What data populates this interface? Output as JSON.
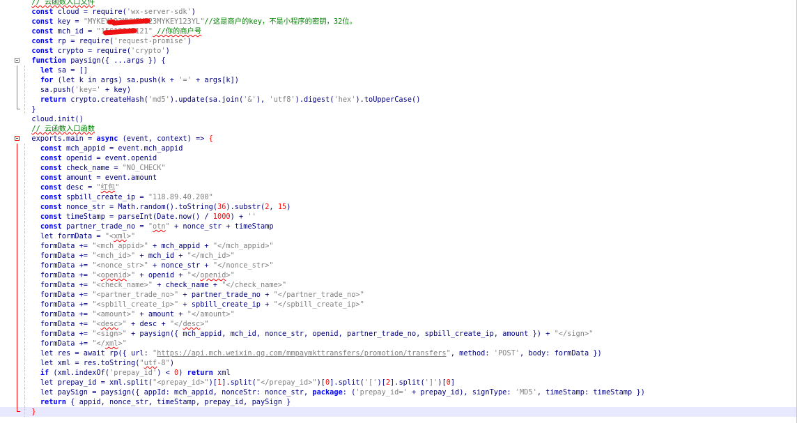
{
  "editor": {
    "lines": [
      [
        {
          "t": "  "
        },
        {
          "t": "// 云函数入口文件",
          "c": "cm",
          "u": true
        }
      ],
      [
        {
          "t": "  "
        },
        {
          "t": "const",
          "c": "kw"
        },
        {
          "t": " cloud = require("
        },
        {
          "t": "'wx-server-sdk'",
          "c": "st"
        },
        {
          "t": ")"
        }
      ],
      [
        {
          "t": "  "
        },
        {
          "t": "const",
          "c": "kw"
        },
        {
          "t": " key = "
        },
        {
          "t": "\"MYKEY",
          "c": "st"
        },
        {
          "t": "1",
          "c": "st",
          "r": true
        },
        {
          "t": "23MYKEY1",
          "c": "st",
          "r": true
        },
        {
          "t": "23MYKEY123YL\"",
          "c": "st"
        },
        {
          "t": "//这是商户的key，不是小程序的密钥，32位。",
          "c": "cm"
        }
      ],
      [
        {
          "t": "  "
        },
        {
          "t": "const",
          "c": "kw"
        },
        {
          "t": " mch_id = "
        },
        {
          "t": "\"1",
          "c": "st"
        },
        {
          "t": "5612345",
          "c": "st",
          "r": true
        },
        {
          "t": "121\"",
          "c": "st"
        },
        {
          "t": " //你的商户号",
          "c": "cm",
          "u": true
        }
      ],
      [
        {
          "t": "  "
        },
        {
          "t": "const",
          "c": "kw"
        },
        {
          "t": " rp = require("
        },
        {
          "t": "'request-promise'",
          "c": "st"
        },
        {
          "t": ")"
        }
      ],
      [
        {
          "t": "  "
        },
        {
          "t": "const",
          "c": "kw"
        },
        {
          "t": " crypto = require("
        },
        {
          "t": "'crypto'",
          "c": "st"
        },
        {
          "t": ")"
        }
      ],
      [
        {
          "t": "  "
        },
        {
          "t": "function",
          "c": "kw"
        },
        {
          "t": " paysign({ ...args }) {"
        }
      ],
      [
        {
          "t": "    "
        },
        {
          "t": "let",
          "c": "kw"
        },
        {
          "t": " sa = []"
        }
      ],
      [
        {
          "t": "    "
        },
        {
          "t": "for",
          "c": "kw"
        },
        {
          "t": " (let k in args) sa.push(k + "
        },
        {
          "t": "'='",
          "c": "st"
        },
        {
          "t": " + args[k])"
        }
      ],
      [
        {
          "t": "    "
        },
        {
          "t": "sa.push("
        },
        {
          "t": "'key='",
          "c": "st"
        },
        {
          "t": " + key)"
        }
      ],
      [
        {
          "t": "    "
        },
        {
          "t": "return",
          "c": "kw"
        },
        {
          "t": " crypto.createHash("
        },
        {
          "t": "'md5'",
          "c": "st"
        },
        {
          "t": ").update(sa.join("
        },
        {
          "t": "'&'",
          "c": "st"
        },
        {
          "t": "), "
        },
        {
          "t": "'utf8'",
          "c": "st"
        },
        {
          "t": ").digest("
        },
        {
          "t": "'hex'",
          "c": "st"
        },
        {
          "t": ").toUpperCase()"
        }
      ],
      [
        {
          "t": "  "
        },
        {
          "t": "}"
        }
      ],
      [
        {
          "t": "  "
        },
        {
          "t": "cloud.init()"
        }
      ],
      [
        {
          "t": "  "
        },
        {
          "t": "// 云函数入口函数",
          "c": "cm",
          "u": true
        }
      ],
      [
        {
          "t": "  "
        },
        {
          "t": "exports.main = "
        },
        {
          "t": "async",
          "c": "kw"
        },
        {
          "t": " (event, context) => "
        },
        {
          "t": "{",
          "c": "brk"
        }
      ],
      [
        {
          "t": "    "
        },
        {
          "t": "const",
          "c": "kw"
        },
        {
          "t": " mch_appid = event.mch_appid"
        }
      ],
      [
        {
          "t": "    "
        },
        {
          "t": "const",
          "c": "kw"
        },
        {
          "t": " openid = event.openid"
        }
      ],
      [
        {
          "t": "    "
        },
        {
          "t": "const",
          "c": "kw"
        },
        {
          "t": " check_name = "
        },
        {
          "t": "\"NO_CHECK\"",
          "c": "st"
        }
      ],
      [
        {
          "t": "    "
        },
        {
          "t": "const",
          "c": "kw"
        },
        {
          "t": " amount = event.amount"
        }
      ],
      [
        {
          "t": "    "
        },
        {
          "t": "const",
          "c": "kw"
        },
        {
          "t": " desc = "
        },
        {
          "t": "\"",
          "c": "st"
        },
        {
          "t": "红包",
          "c": "st",
          "u": true
        },
        {
          "t": "\"",
          "c": "st"
        }
      ],
      [
        {
          "t": "    "
        },
        {
          "t": "const",
          "c": "kw"
        },
        {
          "t": " spbill_create_ip = "
        },
        {
          "t": "\"118.89.40.200\"",
          "c": "st"
        }
      ],
      [
        {
          "t": "    "
        },
        {
          "t": "const",
          "c": "kw"
        },
        {
          "t": " nonce_str = Math.random().toString("
        },
        {
          "t": "36",
          "c": "num"
        },
        {
          "t": ").substr("
        },
        {
          "t": "2",
          "c": "num"
        },
        {
          "t": ", "
        },
        {
          "t": "15",
          "c": "num"
        },
        {
          "t": ")"
        }
      ],
      [
        {
          "t": "    "
        },
        {
          "t": "const",
          "c": "kw"
        },
        {
          "t": " timeStamp = parseInt(Date.now() / "
        },
        {
          "t": "1000",
          "c": "num"
        },
        {
          "t": ") + "
        },
        {
          "t": "''",
          "c": "st"
        }
      ],
      [
        {
          "t": "    "
        },
        {
          "t": "const",
          "c": "kw"
        },
        {
          "t": " partner_trade_no = "
        },
        {
          "t": "\"",
          "c": "st"
        },
        {
          "t": "otn",
          "c": "st",
          "u": true
        },
        {
          "t": "\"",
          "c": "st"
        },
        {
          "t": " + nonce_str + timeStamp"
        }
      ],
      [
        {
          "t": "    "
        },
        {
          "t": "let formData = "
        },
        {
          "t": "\"<",
          "c": "st"
        },
        {
          "t": "xml",
          "c": "st",
          "u": true
        },
        {
          "t": ">\"",
          "c": "st"
        }
      ],
      [
        {
          "t": "    "
        },
        {
          "t": "formData += "
        },
        {
          "t": "\"<mch_appid>\"",
          "c": "st"
        },
        {
          "t": " + mch_appid + "
        },
        {
          "t": "\"</mch_appid>\"",
          "c": "st"
        }
      ],
      [
        {
          "t": "    "
        },
        {
          "t": "formData += "
        },
        {
          "t": "\"<mch_id>\"",
          "c": "st"
        },
        {
          "t": " + mch_id + "
        },
        {
          "t": "\"</mch_id>\"",
          "c": "st"
        }
      ],
      [
        {
          "t": "    "
        },
        {
          "t": "formData += "
        },
        {
          "t": "\"<nonce_str>\"",
          "c": "st"
        },
        {
          "t": " + nonce_str + "
        },
        {
          "t": "\"</nonce_str>\"",
          "c": "st"
        }
      ],
      [
        {
          "t": "    "
        },
        {
          "t": "formData += "
        },
        {
          "t": "\"<",
          "c": "st"
        },
        {
          "t": "openid",
          "c": "st",
          "u": true
        },
        {
          "t": ">\"",
          "c": "st"
        },
        {
          "t": " + openid + "
        },
        {
          "t": "\"</",
          "c": "st"
        },
        {
          "t": "openid",
          "c": "st",
          "u": true
        },
        {
          "t": ">\"",
          "c": "st"
        }
      ],
      [
        {
          "t": "    "
        },
        {
          "t": "formData += "
        },
        {
          "t": "\"<check_name>\"",
          "c": "st"
        },
        {
          "t": " + check_name + "
        },
        {
          "t": "\"</check_name>\"",
          "c": "st"
        }
      ],
      [
        {
          "t": "    "
        },
        {
          "t": "formData += "
        },
        {
          "t": "\"<partner_trade_no>\"",
          "c": "st"
        },
        {
          "t": " + partner_trade_no + "
        },
        {
          "t": "\"</partner_trade_no>\"",
          "c": "st"
        }
      ],
      [
        {
          "t": "    "
        },
        {
          "t": "formData += "
        },
        {
          "t": "\"<spbill_create_ip>\"",
          "c": "st"
        },
        {
          "t": " + spbill_create_ip + "
        },
        {
          "t": "\"</spbill_create_ip>\"",
          "c": "st"
        }
      ],
      [
        {
          "t": "    "
        },
        {
          "t": "formData += "
        },
        {
          "t": "\"<amount>\"",
          "c": "st"
        },
        {
          "t": " + amount + "
        },
        {
          "t": "\"</amount>\"",
          "c": "st"
        }
      ],
      [
        {
          "t": "    "
        },
        {
          "t": "formData += "
        },
        {
          "t": "\"<",
          "c": "st"
        },
        {
          "t": "desc",
          "c": "st",
          "u": true
        },
        {
          "t": ">\"",
          "c": "st"
        },
        {
          "t": " + desc + "
        },
        {
          "t": "\"</",
          "c": "st"
        },
        {
          "t": "desc",
          "c": "st",
          "u": true
        },
        {
          "t": ">\"",
          "c": "st"
        }
      ],
      [
        {
          "t": "    "
        },
        {
          "t": "formData += "
        },
        {
          "t": "\"<sign>\"",
          "c": "st"
        },
        {
          "t": " + paysign({ mch_appid, mch_id, nonce_str, openid, partner_trade_no, spbill_create_ip, amount }) + "
        },
        {
          "t": "\"</sign>\"",
          "c": "st"
        }
      ],
      [
        {
          "t": "    "
        },
        {
          "t": "formData += "
        },
        {
          "t": "\"</",
          "c": "st"
        },
        {
          "t": "xml",
          "c": "st",
          "u": true
        },
        {
          "t": ">\"",
          "c": "st"
        }
      ],
      [
        {
          "t": "    "
        },
        {
          "t": "let res = await rp({ url: "
        },
        {
          "t": "\"",
          "c": "st"
        },
        {
          "t": "https://api.mch.weixin.qq.com/mmpaymkttransfers/promotion/transfers",
          "c": "st",
          "l": true
        },
        {
          "t": "\"",
          "c": "st"
        },
        {
          "t": ", method: "
        },
        {
          "t": "'POST'",
          "c": "st"
        },
        {
          "t": ", body: formData })"
        }
      ],
      [
        {
          "t": "    "
        },
        {
          "t": "let xml = res.toString("
        },
        {
          "t": "\"",
          "c": "st"
        },
        {
          "t": "utf",
          "c": "st",
          "u": true
        },
        {
          "t": "-8\"",
          "c": "st"
        },
        {
          "t": ")"
        }
      ],
      [
        {
          "t": "    "
        },
        {
          "t": "if",
          "c": "kw"
        },
        {
          "t": " (xml.indexOf("
        },
        {
          "t": "'prepay_id'",
          "c": "st"
        },
        {
          "t": ") < "
        },
        {
          "t": "0",
          "c": "num"
        },
        {
          "t": ") "
        },
        {
          "t": "return",
          "c": "kw"
        },
        {
          "t": " xml"
        }
      ],
      [
        {
          "t": "    "
        },
        {
          "t": "let prepay_id = xml.split("
        },
        {
          "t": "\"<prepay_id>\"",
          "c": "st"
        },
        {
          "t": ")["
        },
        {
          "t": "1",
          "c": "num"
        },
        {
          "t": "].split("
        },
        {
          "t": "\"</prepay_id>\"",
          "c": "st"
        },
        {
          "t": ")["
        },
        {
          "t": "0",
          "c": "num"
        },
        {
          "t": "].split("
        },
        {
          "t": "'['",
          "c": "st"
        },
        {
          "t": ")["
        },
        {
          "t": "2",
          "c": "num"
        },
        {
          "t": "].split("
        },
        {
          "t": "']'",
          "c": "st"
        },
        {
          "t": ")["
        },
        {
          "t": "0",
          "c": "num"
        },
        {
          "t": "]"
        }
      ],
      [
        {
          "t": "    "
        },
        {
          "t": "let paySign = paysign({ appId: mch_appid, nonceStr: nonce_str, "
        },
        {
          "t": "package",
          "c": "kw"
        },
        {
          "t": ": ("
        },
        {
          "t": "'prepay_id='",
          "c": "st"
        },
        {
          "t": " + prepay_id), signType: "
        },
        {
          "t": "'MD5'",
          "c": "st"
        },
        {
          "t": ", timeStamp: timeStamp })"
        }
      ],
      [
        {
          "t": "    "
        },
        {
          "t": "return",
          "c": "kw"
        },
        {
          "t": " { appid, nonce_str, timeStamp, prepay_id, paySign }"
        }
      ],
      [
        {
          "t": "  "
        },
        {
          "t": "}",
          "c": "brk"
        }
      ]
    ]
  }
}
